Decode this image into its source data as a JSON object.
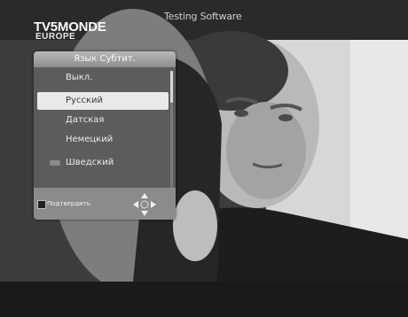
{
  "header": {
    "title": "Testing Software",
    "channel_logo": "TV5MONDE",
    "channel_logo_sub": "EUROPE"
  },
  "menu": {
    "title": "Язык Субтит.",
    "items": [
      {
        "label": "Выкл.",
        "selected": false,
        "marker": false
      },
      {
        "label": "Русский",
        "selected": true,
        "marker": false
      },
      {
        "label": "Датская",
        "selected": false,
        "marker": false
      },
      {
        "label": "Немецкий",
        "selected": false,
        "marker": false
      },
      {
        "label": "Шведский",
        "selected": false,
        "marker": true
      }
    ],
    "footer": {
      "confirm_label": "Подтвердить",
      "ok_icon": "ok-button-icon",
      "nav_icon": "navigation-arrows-icon"
    }
  },
  "colors": {
    "menu_background": "#5c5c5c",
    "menu_title": "#a8a8a8",
    "selected_item": "#e9e9e9"
  }
}
